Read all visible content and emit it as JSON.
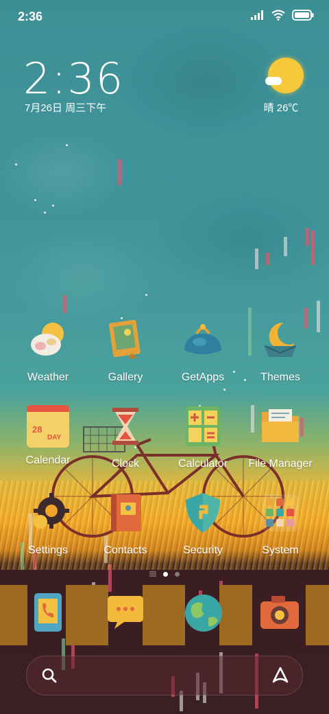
{
  "status_bar": {
    "time": "2:36"
  },
  "clock_widget": {
    "time": "2:36",
    "date": "7月26日 周三下午"
  },
  "weather_widget": {
    "text": "晴 26℃"
  },
  "apps": [
    {
      "label": "Weather",
      "icon": "weather-icon"
    },
    {
      "label": "Gallery",
      "icon": "gallery-icon"
    },
    {
      "label": "GetApps",
      "icon": "getapps-icon"
    },
    {
      "label": "Themes",
      "icon": "themes-icon"
    },
    {
      "label": "Calendar",
      "icon": "calendar-icon",
      "icon_text": "28",
      "icon_subtext": "DAY"
    },
    {
      "label": "Clock",
      "icon": "clock-icon"
    },
    {
      "label": "Calculator",
      "icon": "calculator-icon"
    },
    {
      "label": "File Manager",
      "icon": "file-manager-icon"
    },
    {
      "label": "Settings",
      "icon": "settings-icon"
    },
    {
      "label": "Contacts",
      "icon": "contacts-icon"
    },
    {
      "label": "Security",
      "icon": "security-icon"
    },
    {
      "label": "System",
      "icon": "system-folder-icon"
    }
  ],
  "dock": [
    {
      "icon": "phone-icon"
    },
    {
      "icon": "messages-icon"
    },
    {
      "icon": "browser-icon"
    },
    {
      "icon": "camera-icon"
    }
  ],
  "page_indicator": {
    "pages": 2,
    "current": 1
  },
  "search_bar": {
    "left_icon": "search-icon",
    "right_icon": "assistant-icon"
  },
  "colors": {
    "sky": "#3f959a",
    "grass": "#f0a52a",
    "ground": "#3a1f25",
    "sun": "#f7c93a"
  }
}
